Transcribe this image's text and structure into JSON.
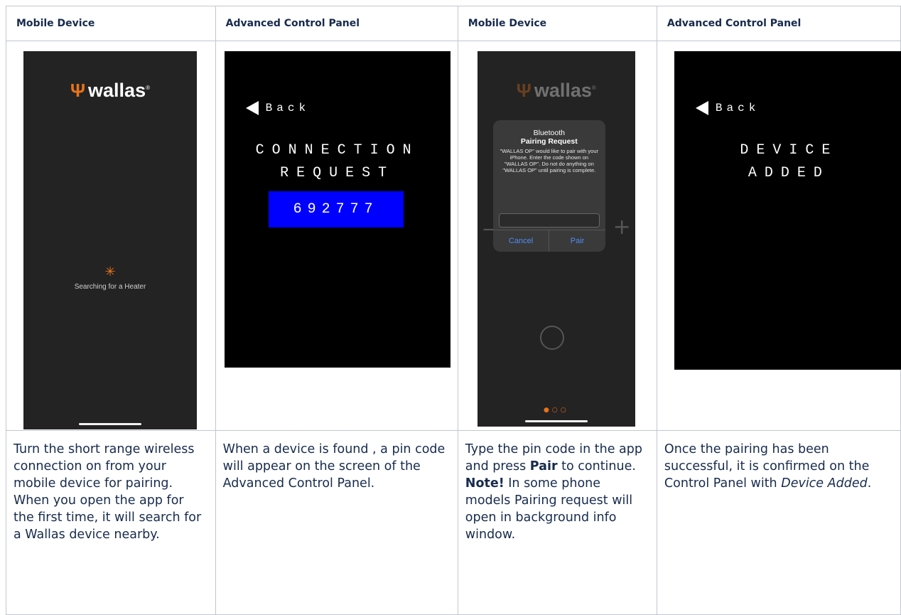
{
  "headers": [
    "Mobile Device",
    "Advanced Control Panel",
    "Mobile Device",
    "Advanced Control Panel"
  ],
  "screen1": {
    "brand": "wallas",
    "status": "Searching for a Heater"
  },
  "screen2": {
    "back": "Back",
    "title_line1": "CONNECTION",
    "title_line2": "REQUEST",
    "pin": "692777"
  },
  "screen3": {
    "brand": "wallas",
    "dialog_title_line1": "Bluetooth",
    "dialog_title_line2": "Pairing Request",
    "dialog_body": "\"WALLAS OP\" would like to pair with your iPhone. Enter the code shown on \"WALLAS OP\". Do not do anything on \"WALLAS OP\" until pairing is complete.",
    "cancel": "Cancel",
    "pair": "Pair"
  },
  "screen4": {
    "back": "Back",
    "title_line1": "DEVICE",
    "title_line2": "ADDED"
  },
  "descriptions": {
    "d1_a": "Turn the short range wireless connection on from your mobile device for pairing.",
    "d1_b": "When you open the app for the first time, it will search for a Wallas device nearby.",
    "d2": "When a device is found , a pin code will appear on the screen of the Advanced Control Panel.",
    "d3_a": "Type the pin code in the app and press ",
    "d3_pair": "Pair",
    "d3_b": " to continue. ",
    "d3_note": "Note!",
    "d3_c": " In some phone models Pairing request will open in background info window.",
    "d4_a": "Once the pairing has been successful, it is confirmed on the Control Panel with ",
    "d4_em": "Device Added",
    "d4_b": "."
  },
  "colors": {
    "accent_orange": "#e8731a",
    "pin_blue": "#0000ff",
    "ios_blue": "#4d8df7"
  }
}
